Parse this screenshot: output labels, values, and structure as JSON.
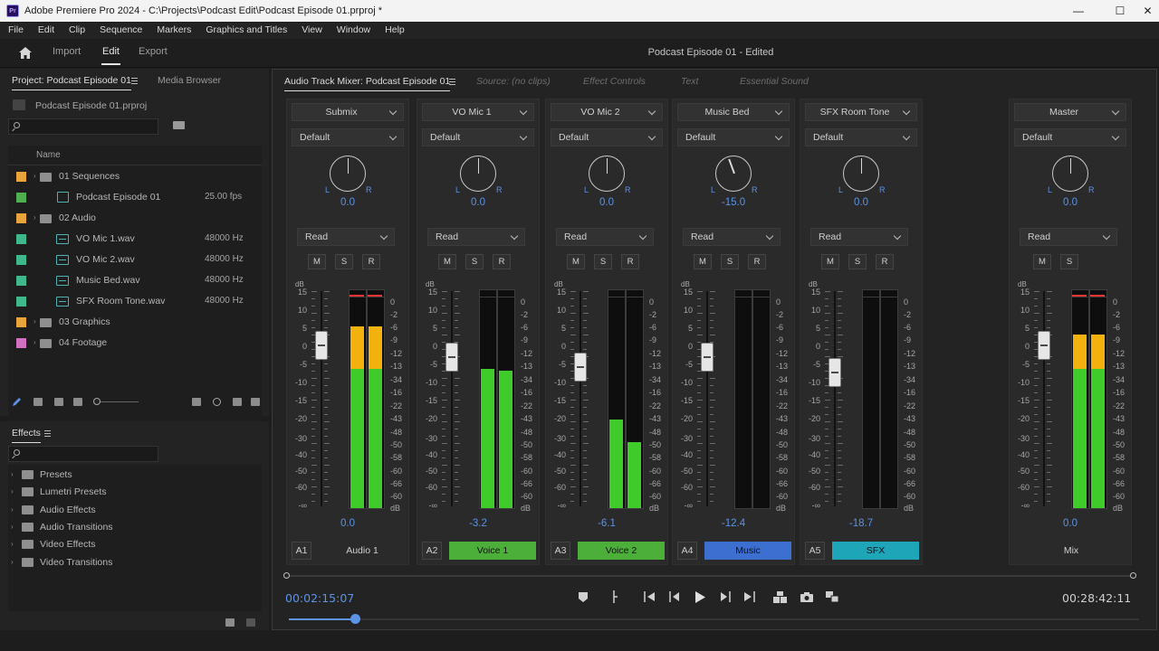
{
  "titlebar": {
    "app_title": "Adobe Premiere Pro 2024 - C:\\Projects\\Podcast Edit\\Podcast Episode 01.prproj *",
    "logo": "Pr"
  },
  "menu": [
    "File",
    "Edit",
    "Clip",
    "Sequence",
    "Markers",
    "Graphics and Titles",
    "View",
    "Window",
    "Help"
  ],
  "workspace": {
    "tabs": [
      "Import",
      "Edit",
      "Export"
    ],
    "active": "Edit",
    "doc_title": "Podcast Episode 01 - Edited"
  },
  "project": {
    "tab_label": "Project: Podcast Episode 01",
    "media_browser_label": "Media Browser",
    "file": "Podcast Episode 01.prproj",
    "column_name": "Name",
    "items": [
      {
        "name": "01 Sequences",
        "type": "folder",
        "color": "#e8a33a",
        "meta": "",
        "indent": 0
      },
      {
        "name": "Podcast Episode 01",
        "type": "sequence",
        "color": "#4fae4f",
        "meta": "25.00 fps",
        "indent": 1
      },
      {
        "name": "02 Audio",
        "type": "folder",
        "color": "#e8a33a",
        "meta": "",
        "indent": 0
      },
      {
        "name": "VO Mic 1.wav",
        "type": "audio",
        "color": "#3fb98c",
        "meta": "48000 Hz",
        "indent": 1
      },
      {
        "name": "VO Mic 2.wav",
        "type": "audio",
        "color": "#3fb98c",
        "meta": "48000 Hz",
        "indent": 1
      },
      {
        "name": "Music Bed.wav",
        "type": "audio",
        "color": "#3fb98c",
        "meta": "48000 Hz",
        "indent": 1
      },
      {
        "name": "SFX Room Tone.wav",
        "type": "audio",
        "color": "#3fb98c",
        "meta": "48000 Hz",
        "indent": 1
      },
      {
        "name": "03 Graphics",
        "type": "folder",
        "color": "#e8a33a",
        "meta": "",
        "indent": 0
      },
      {
        "name": "04 Footage",
        "type": "folder",
        "color": "#d070c0",
        "meta": "",
        "indent": 0
      }
    ]
  },
  "effects": {
    "tab_label": "Effects",
    "items": [
      "Presets",
      "Lumetri Presets",
      "Audio Effects",
      "Audio Transitions",
      "Video Effects",
      "Video Transitions"
    ]
  },
  "mixer": {
    "tabs": [
      {
        "label": "Audio Track Mixer: Podcast Episode 01",
        "state": "active"
      },
      {
        "label": "Source: (no clips)",
        "state": "dim"
      },
      {
        "label": "Effect Controls",
        "state": "dim"
      },
      {
        "label": "Text",
        "state": "dim"
      },
      {
        "label": "Essential Sound",
        "state": "dim"
      }
    ],
    "db_label": "dB",
    "fader_scale": [
      "15",
      "10",
      "5",
      "0",
      "-5",
      "-10",
      "-15",
      "-20",
      "-30",
      "-40",
      "-50",
      "-60",
      "-∞"
    ],
    "meter_scale": [
      "0",
      "-2",
      "-6",
      "-9",
      "-12",
      "-13",
      "-34",
      "-16",
      "-22",
      "-43",
      "-48",
      "-50",
      "-58",
      "-60",
      "-66",
      "-60",
      "dB"
    ],
    "pan_l": "L",
    "pan_r": "R",
    "strips": [
      {
        "id": "A1",
        "header": "Submix",
        "preset": "Default",
        "pan": "0.0",
        "pan_angle": 0,
        "mode": "Read",
        "buttons": [
          "M",
          "S",
          "R"
        ],
        "volume": "0.0",
        "fader_db": 0,
        "meter": {
          "left": 0.86,
          "right": 0.86,
          "peak": true
        },
        "name": "Audio 1",
        "name_color": ""
      },
      {
        "id": "A2",
        "header": "VO Mic 1",
        "preset": "Default",
        "pan": "0.0",
        "pan_angle": 0,
        "mode": "Read",
        "buttons": [
          "M",
          "S",
          "R"
        ],
        "volume": "-3.2",
        "fader_db": -3.2,
        "meter": {
          "left": 0.66,
          "right": 0.65,
          "peak": false
        },
        "name": "Voice 1",
        "name_color": "#4caf39"
      },
      {
        "id": "A3",
        "header": "VO Mic 2",
        "preset": "Default",
        "pan": "0.0",
        "pan_angle": 0,
        "mode": "Read",
        "buttons": [
          "M",
          "S",
          "R"
        ],
        "volume": "-6.1",
        "fader_db": -6.1,
        "meter": {
          "left": 0.42,
          "right": 0.31,
          "peak": false
        },
        "name": "Voice 2",
        "name_color": "#4caf39"
      },
      {
        "id": "A4",
        "header": "Music Bed",
        "preset": "Default",
        "pan": "-15.0",
        "pan_angle": -20,
        "mode": "Read",
        "buttons": [
          "M",
          "S",
          "R"
        ],
        "volume": "-12.4",
        "fader_db": -3.2,
        "meter": {
          "left": 0.0,
          "right": 0.0,
          "peak": false
        },
        "name": "Music",
        "name_color": "#3d6fd1"
      },
      {
        "id": "A5",
        "header": "SFX Room Tone",
        "preset": "Default",
        "pan": "0.0",
        "pan_angle": 0,
        "mode": "Read",
        "buttons": [
          "M",
          "S",
          "R"
        ],
        "volume": "-18.7",
        "fader_db": -7.5,
        "meter": {
          "left": 0.0,
          "right": 0.0,
          "peak": false
        },
        "name": "SFX",
        "name_color": "#1ea6b8"
      }
    ],
    "master": {
      "header": "Master",
      "preset": "Default",
      "pan": "0.0",
      "pan_angle": 0,
      "mode": "Read",
      "buttons": [
        "M",
        "S"
      ],
      "volume": "0.0",
      "fader_db": 0,
      "meter": {
        "left": 0.82,
        "right": 0.82,
        "peak": true
      },
      "name": "Mix"
    }
  },
  "transport": {
    "current_tc": "00:02:15:07",
    "duration_tc": "00:28:42:11",
    "playhead_fraction": 0.078
  },
  "colors": {
    "accent_blue": "#5b93e6",
    "meter_green": "#3fcc2a",
    "meter_yellow": "#f2b10c"
  }
}
